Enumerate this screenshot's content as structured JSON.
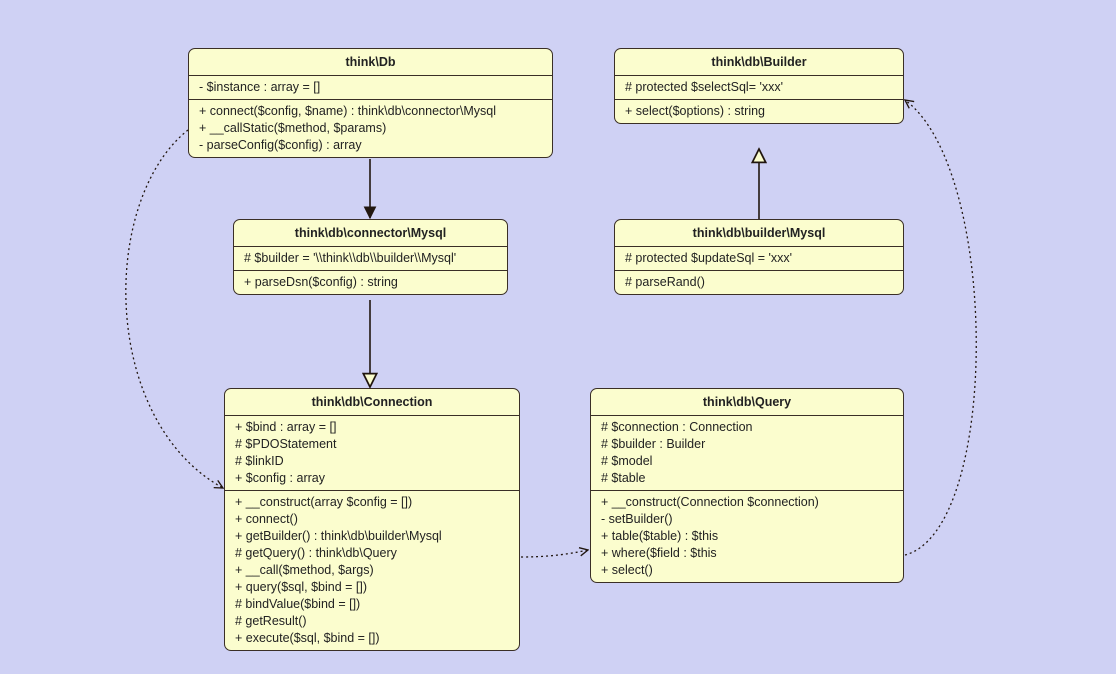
{
  "classes": {
    "db": {
      "title": "think\\Db",
      "attrs": [
        "- $instance : array = []"
      ],
      "methods": [
        "+ connect($config, $name) : think\\db\\connector\\Mysql",
        "+ __callStatic($method, $params)",
        "- parseConfig($config) : array"
      ]
    },
    "builder": {
      "title": "think\\db\\Builder",
      "attrs": [
        "# protected $selectSql= 'xxx'"
      ],
      "methods": [
        "+ select($options) : string"
      ]
    },
    "connectorMysql": {
      "title": "think\\db\\connector\\Mysql",
      "attrs": [
        "# $builder = '\\\\think\\\\db\\\\builder\\\\Mysql'"
      ],
      "methods": [
        "+ parseDsn($config) : string"
      ]
    },
    "builderMysql": {
      "title": "think\\db\\builder\\Mysql",
      "attrs": [
        "# protected $updateSql = 'xxx'"
      ],
      "methods": [
        "# parseRand()"
      ]
    },
    "connection": {
      "title": "think\\db\\Connection",
      "attrs": [
        "+ $bind : array = []",
        "# $PDOStatement",
        "# $linkID",
        "+ $config : array"
      ],
      "methods": [
        "+ __construct(array $config = [])",
        "+ connect()",
        "+ getBuilder() : think\\db\\builder\\Mysql",
        "# getQuery() : think\\db\\Query",
        "+ __call($method, $args)",
        "+ query($sql, $bind = [])",
        "# bindValue($bind = [])",
        "# getResult()",
        "+ execute($sql, $bind = [])"
      ]
    },
    "query": {
      "title": "think\\db\\Query",
      "attrs": [
        "# $connection : Connection",
        "# $builder : Builder",
        "# $model",
        "# $table"
      ],
      "methods": [
        "+ __construct(Connection $connection)",
        "- setBuilder()",
        "+ table($table) : $this",
        "+ where($field : $this",
        "+ select()"
      ]
    }
  }
}
